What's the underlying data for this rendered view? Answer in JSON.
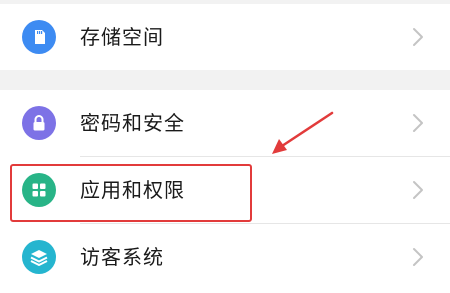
{
  "settings": {
    "items": [
      {
        "label": "存储空间",
        "icon": "sd-card-icon",
        "color": "#3d8bf2"
      },
      {
        "label": "密码和安全",
        "icon": "lock-icon",
        "color": "#7d72e6"
      },
      {
        "label": "应用和权限",
        "icon": "apps-grid-icon",
        "color": "#28b487"
      },
      {
        "label": "访客系统",
        "icon": "layers-icon",
        "color": "#25b5cf"
      }
    ]
  },
  "annotation": {
    "highlight_color": "#e23b3b",
    "arrow_color": "#e23b3b",
    "highlighted_item": "应用和权限"
  }
}
